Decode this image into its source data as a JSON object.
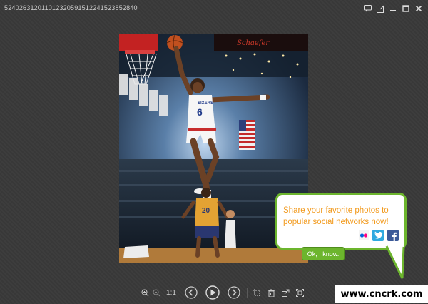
{
  "window": {
    "title": "524026312011012320591512241523852840"
  },
  "toolbar": {
    "zoom_label": "1:1"
  },
  "tooltip": {
    "message": "Share your favorite photos to popular social networks now!",
    "ok_label": "Ok, I know."
  },
  "photo": {
    "jersey_number": "6",
    "jersey_team": "SIXERS",
    "arena_sign": "Schaefer",
    "opponent_number": "20"
  },
  "watermark": {
    "text": "www.cncrk.com"
  },
  "colors": {
    "accent_green": "#6cb52d",
    "tooltip_text": "#f29a1d",
    "flickr_pink": "#ff0084",
    "flickr_blue": "#0063dc",
    "twitter_blue": "#2fa9e0",
    "facebook_blue": "#3b5998"
  },
  "icons": [
    "chat-icon",
    "pin-icon",
    "minimize-icon",
    "maximize-icon",
    "close-icon",
    "zoom-in-icon",
    "zoom-out-icon",
    "prev-icon",
    "play-icon",
    "next-icon",
    "crop-icon",
    "delete-icon",
    "share-icon",
    "fullscreen-icon",
    "flickr-icon",
    "twitter-icon",
    "facebook-icon"
  ]
}
